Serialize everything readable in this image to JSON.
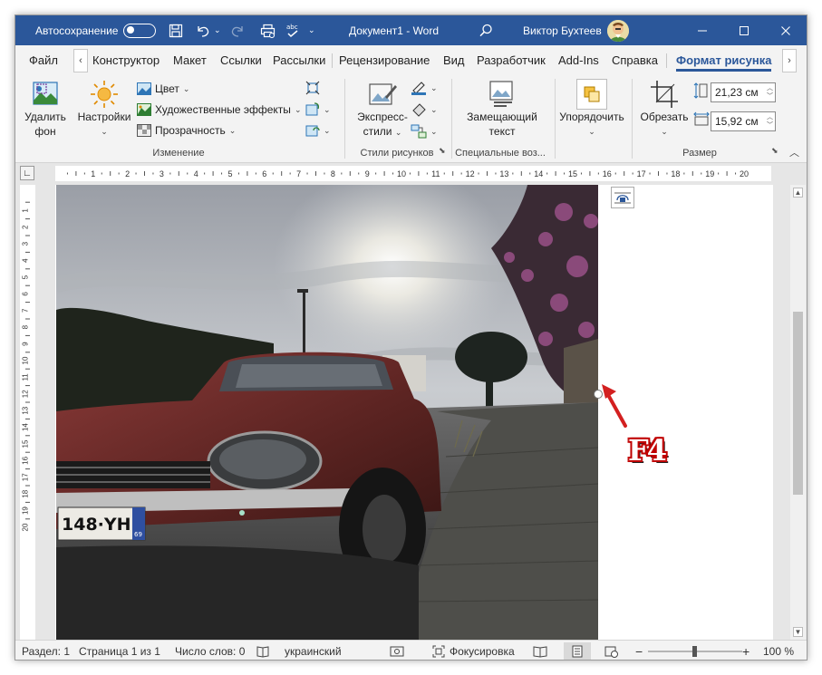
{
  "titlebar": {
    "autosave_label": "Автосохранение",
    "doc_title": "Документ1  -  Word",
    "user_name": "Виктор Бухтеев",
    "icons": [
      "save-icon",
      "undo-icon",
      "redo-icon",
      "print-preview-icon",
      "spelling-icon",
      "search-icon"
    ]
  },
  "tabs": {
    "items": [
      "Файл",
      "Конструктор",
      "Макет",
      "Ссылки",
      "Рассылки",
      "Рецензирование",
      "Вид",
      "Разработчик",
      "Add-Ins",
      "Справка",
      "Формат рисунка"
    ],
    "active": "Формат рисунка"
  },
  "ribbon": {
    "remove_bg": [
      "Удалить",
      "фон"
    ],
    "corrections": "Настройки",
    "color": "Цвет",
    "artistic": "Художественные эффекты",
    "transparency": "Прозрачность",
    "group_adjust": "Изменение",
    "quick_styles": [
      "Экспресс-",
      "стили"
    ],
    "group_styles": "Стили рисунков",
    "alt_text": [
      "Замещающий",
      "текст"
    ],
    "group_special": "Специальные воз...",
    "arrange": "Упорядочить",
    "crop": "Обрезать",
    "height": "21,23 см",
    "width": "15,92 см",
    "group_size": "Размер"
  },
  "ruler": {
    "h_labels": [
      "1",
      "2",
      "3",
      "4",
      "5",
      "6",
      "7",
      "8",
      "9",
      "10",
      "11",
      "12",
      "13",
      "14",
      "15",
      "16",
      "17",
      "18",
      "19",
      "20"
    ],
    "v_labels": [
      "1",
      "2",
      "3",
      "4",
      "5",
      "6",
      "7",
      "8",
      "9",
      "10",
      "11",
      "12",
      "13",
      "14",
      "15",
      "16",
      "17",
      "18",
      "19",
      "20"
    ]
  },
  "photo": {
    "plate": "148·YH",
    "plate_region": "69"
  },
  "annotation": {
    "label": "F4",
    "color": "#d32020"
  },
  "statusbar": {
    "section": "Раздел: 1",
    "page": "Страница 1 из 1",
    "words": "Число слов: 0",
    "language": "украинский",
    "focus": "Фокусировка",
    "zoom": "100 %"
  },
  "colors": {
    "accent": "#2b579a"
  }
}
